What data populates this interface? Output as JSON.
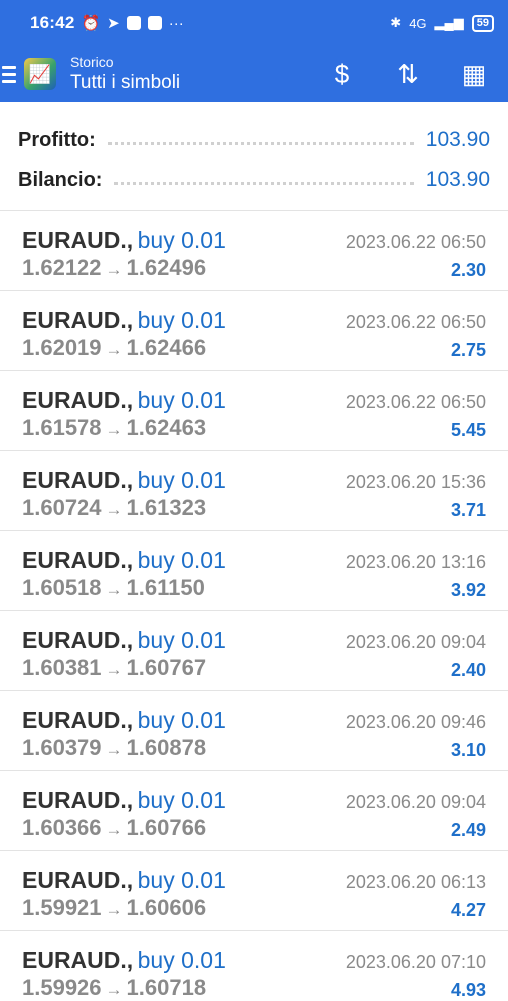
{
  "status_bar": {
    "time": "16:42",
    "network": "4G",
    "battery": "59"
  },
  "app_bar": {
    "subtitle": "Storico",
    "title": "Tutti i simboli",
    "icons": [
      "menu-icon",
      "app-logo-icon",
      "currency-exchange-icon",
      "sort-icon",
      "calendar-icon"
    ]
  },
  "summary": {
    "profit_label": "Profitto:",
    "profit_value": "103.90",
    "balance_label": "Bilancio:",
    "balance_value": "103.90"
  },
  "colors": {
    "accent": "#2f6fe0",
    "value_blue": "#1e6fc9"
  },
  "deals": [
    {
      "symbol": "EURAUD.,",
      "direction": "buy 0.01",
      "open": "1.62122",
      "close": "1.62496",
      "time": "2023.06.22 06:50",
      "profit": "2.30"
    },
    {
      "symbol": "EURAUD.,",
      "direction": "buy 0.01",
      "open": "1.62019",
      "close": "1.62466",
      "time": "2023.06.22 06:50",
      "profit": "2.75"
    },
    {
      "symbol": "EURAUD.,",
      "direction": "buy 0.01",
      "open": "1.61578",
      "close": "1.62463",
      "time": "2023.06.22 06:50",
      "profit": "5.45"
    },
    {
      "symbol": "EURAUD.,",
      "direction": "buy 0.01",
      "open": "1.60724",
      "close": "1.61323",
      "time": "2023.06.20 15:36",
      "profit": "3.71"
    },
    {
      "symbol": "EURAUD.,",
      "direction": "buy 0.01",
      "open": "1.60518",
      "close": "1.61150",
      "time": "2023.06.20 13:16",
      "profit": "3.92"
    },
    {
      "symbol": "EURAUD.,",
      "direction": "buy 0.01",
      "open": "1.60381",
      "close": "1.60767",
      "time": "2023.06.20 09:04",
      "profit": "2.40"
    },
    {
      "symbol": "EURAUD.,",
      "direction": "buy 0.01",
      "open": "1.60379",
      "close": "1.60878",
      "time": "2023.06.20 09:46",
      "profit": "3.10"
    },
    {
      "symbol": "EURAUD.,",
      "direction": "buy 0.01",
      "open": "1.60366",
      "close": "1.60766",
      "time": "2023.06.20 09:04",
      "profit": "2.49"
    },
    {
      "symbol": "EURAUD.,",
      "direction": "buy 0.01",
      "open": "1.59921",
      "close": "1.60606",
      "time": "2023.06.20 06:13",
      "profit": "4.27"
    },
    {
      "symbol": "EURAUD.,",
      "direction": "buy 0.01",
      "open": "1.59926",
      "close": "1.60718",
      "time": "2023.06.20 07:10",
      "profit": "4.93"
    }
  ]
}
